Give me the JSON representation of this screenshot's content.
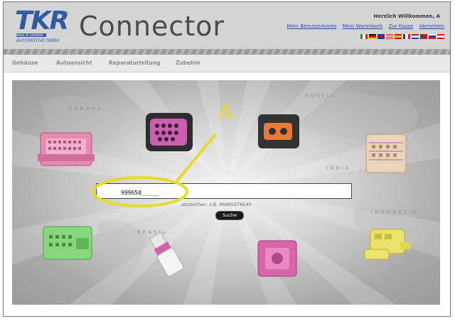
{
  "header": {
    "brand": "Connector",
    "logo_text": "TKR",
    "logo_made_in": "MADE IN GERMANY",
    "logo_company": "AUTOMOTIVE GMBH",
    "welcome": "Herzlich Willkommen, A",
    "links": [
      "Mein Benutzerkonto",
      "Mein Warenkorb",
      "Zur Kasse",
      "Abmelden"
    ]
  },
  "nav": {
    "items": [
      "Gehäuse",
      "Autoansicht",
      "Reparaturleitung",
      "Zubehör"
    ]
  },
  "map_labels": [
    "CANADA",
    "RUSSIA",
    "BRASIL",
    "INDONESIA",
    "INDIA"
  ],
  "search": {
    "value": "999650_____",
    "hint": "atzzeichen; z.B. 99965678540",
    "button": "Suche"
  },
  "annotation": {
    "label": "A",
    "color": "#e6db2b"
  },
  "colors": {
    "link": "#2c4fa6",
    "brand": "#2d5aa0",
    "header_bg": "#d4d4d4",
    "pink": "#d96aa0",
    "green": "#7fcf78",
    "yellow": "#e8e060"
  },
  "flags": [
    "it",
    "de",
    "gb",
    "us",
    "es",
    "fr",
    "nl",
    "pt",
    "ru",
    "other"
  ]
}
